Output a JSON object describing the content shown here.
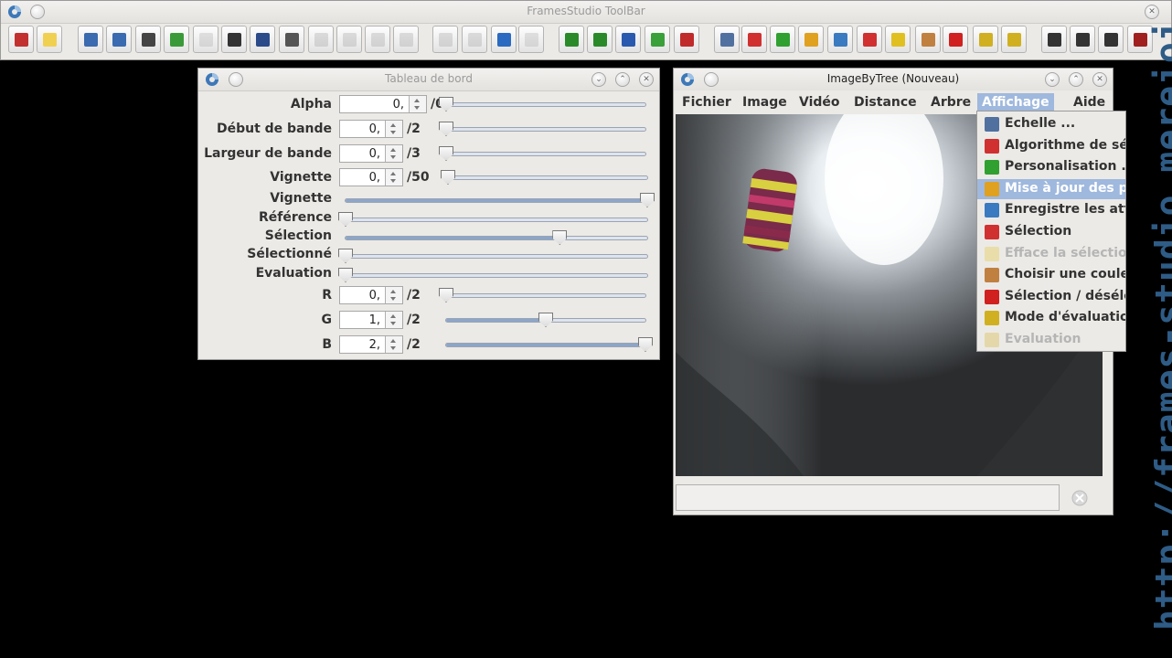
{
  "toolbar_window": {
    "title": "FramesStudio ToolBar",
    "buttons": [
      {
        "icon": "exit-icon",
        "enabled": true
      },
      {
        "icon": "new-document-icon",
        "enabled": true
      },
      {
        "icon": "open-window-icon",
        "enabled": true
      },
      {
        "icon": "window-icon",
        "enabled": true
      },
      {
        "icon": "camera-icon",
        "enabled": true
      },
      {
        "icon": "palette-download-icon",
        "enabled": true
      },
      {
        "icon": "palette-disabled-icon",
        "enabled": false
      },
      {
        "icon": "clapperboard-icon",
        "enabled": true
      },
      {
        "icon": "film-list-icon",
        "enabled": true
      },
      {
        "icon": "webcam-icon",
        "enabled": true
      },
      {
        "icon": "play-icon",
        "enabled": false
      },
      {
        "icon": "rewind-icon",
        "enabled": false
      },
      {
        "icon": "stop-icon",
        "enabled": false
      },
      {
        "icon": "record-icon",
        "enabled": false
      },
      {
        "icon": "pen-icon",
        "enabled": false
      },
      {
        "icon": "stamp-icon",
        "enabled": false
      },
      {
        "icon": "measure-icon",
        "enabled": true
      },
      {
        "icon": "building-icon",
        "enabled": false
      },
      {
        "icon": "tree-icon",
        "enabled": true
      },
      {
        "icon": "tree-add-icon",
        "enabled": true
      },
      {
        "icon": "chart-icon",
        "enabled": true
      },
      {
        "icon": "tree-palette-icon",
        "enabled": true
      },
      {
        "icon": "tree-remove-icon",
        "enabled": true
      },
      {
        "icon": "zoom-icon",
        "enabled": true
      },
      {
        "icon": "algorithm-icon",
        "enabled": true
      },
      {
        "icon": "customize-icon",
        "enabled": true
      },
      {
        "icon": "update-tree-icon",
        "enabled": true
      },
      {
        "icon": "save-attributes-icon",
        "enabled": true
      },
      {
        "icon": "selection-icon",
        "enabled": true
      },
      {
        "icon": "clear-selection-icon",
        "enabled": true
      },
      {
        "icon": "color-picker-icon",
        "enabled": true
      },
      {
        "icon": "pin-icon",
        "enabled": true
      },
      {
        "icon": "evaluation-mode-icon",
        "enabled": true
      },
      {
        "icon": "evaluation-icon",
        "enabled": true
      },
      {
        "icon": "help-icon",
        "enabled": true
      },
      {
        "icon": "copyright-icon",
        "enabled": true
      },
      {
        "icon": "chat-icon",
        "enabled": true
      },
      {
        "icon": "record-video-icon",
        "enabled": true
      }
    ]
  },
  "dashboard": {
    "title": "Tableau de bord",
    "rows": [
      {
        "label": "Alpha",
        "value": "0,",
        "max": "/0",
        "pos": 0.0
      },
      {
        "label": "Début de bande",
        "value": "0,",
        "max": "/2",
        "pos": 0.0
      },
      {
        "label": "Largeur de bande",
        "value": "0,",
        "max": "/3",
        "pos": 0.0
      },
      {
        "label": "Vignette",
        "value": "0,",
        "max": "/50",
        "pos": 0.0
      }
    ],
    "sliders": [
      {
        "label": "Vignette",
        "pos": 1.0
      },
      {
        "label": "Référence",
        "pos": 0.0
      },
      {
        "label": "Sélection",
        "pos": 0.71
      },
      {
        "label": "Sélectionné",
        "pos": 0.0
      },
      {
        "label": "Evaluation",
        "pos": 0.0
      }
    ],
    "rgb": [
      {
        "label": "R",
        "value": "0,",
        "max": "/2",
        "pos": 0.0
      },
      {
        "label": "G",
        "value": "1,",
        "max": "/2",
        "pos": 0.5
      },
      {
        "label": "B",
        "value": "2,",
        "max": "/2",
        "pos": 1.0
      }
    ]
  },
  "image_window": {
    "title": "ImageByTree (Nouveau)",
    "menus": [
      "Fichier",
      "Image",
      "Vidéo",
      "Distance",
      "Arbre",
      "Affichage",
      "Aide"
    ],
    "open_menu": "Affichage",
    "status_text": ""
  },
  "affichage_menu": [
    {
      "label": "Echelle ...",
      "icon": "magnifier-icon",
      "enabled": true,
      "selected": false
    },
    {
      "label": "Algorithme de sélection",
      "icon": "algorithm-icon",
      "enabled": true,
      "selected": false
    },
    {
      "label": "Personalisation ...",
      "icon": "customize-icon",
      "enabled": true,
      "selected": false
    },
    {
      "label": "Mise à jour des propriétés",
      "icon": "update-tree-icon",
      "enabled": true,
      "selected": true
    },
    {
      "label": "Enregistre les attributs",
      "icon": "save-attributes-icon",
      "enabled": true,
      "selected": false
    },
    {
      "label": "Sélection",
      "icon": "selection-icon",
      "enabled": true,
      "selected": false
    },
    {
      "label": "Efface la sélection",
      "icon": "clear-selection-icon",
      "enabled": false,
      "selected": false
    },
    {
      "label": "Choisir une couleur",
      "icon": "color-picker-icon",
      "enabled": true,
      "selected": false
    },
    {
      "label": "Sélection / désélection",
      "icon": "pin-icon",
      "enabled": true,
      "selected": false
    },
    {
      "label": "Mode d'évaluation",
      "icon": "evaluation-mode-icon",
      "enabled": true,
      "selected": false
    },
    {
      "label": "Evaluation",
      "icon": "evaluation-icon",
      "enabled": false,
      "selected": false
    }
  ],
  "watermark": "http://frames-studio.mereioi.fr/"
}
